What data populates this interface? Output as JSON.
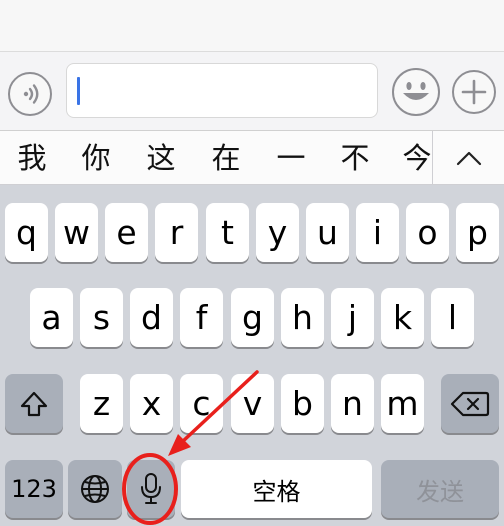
{
  "input_bar": {
    "text_value": "",
    "voice_icon": "voice-waves-icon",
    "emoji_icon": "smiley-face-icon",
    "plus_icon": "plus-icon"
  },
  "candidates": [
    "我",
    "你",
    "这",
    "在",
    "一",
    "不",
    "今"
  ],
  "candidate_expand_icon": "chevron-up-icon",
  "keyboard": {
    "row1": [
      "q",
      "w",
      "e",
      "r",
      "t",
      "y",
      "u",
      "i",
      "o",
      "p"
    ],
    "row2": [
      "a",
      "s",
      "d",
      "f",
      "g",
      "h",
      "j",
      "k",
      "l"
    ],
    "row3": [
      "z",
      "x",
      "c",
      "v",
      "b",
      "n",
      "m"
    ],
    "shift_icon": "shift-arrow-icon",
    "delete_icon": "backspace-icon",
    "numbers_label": "123",
    "globe_icon": "globe-icon",
    "mic_icon": "microphone-icon",
    "space_label": "空格",
    "send_label": "发送"
  },
  "annotation": {
    "color": "#e8201c",
    "marker": "red-arrow-and-circle-highlighting-microphone"
  },
  "colors": {
    "keyboard_bg": "#d1d4da",
    "key_bg": "#ffffff",
    "dark_key_bg": "#a9afb9",
    "caret": "#3a74e6"
  }
}
